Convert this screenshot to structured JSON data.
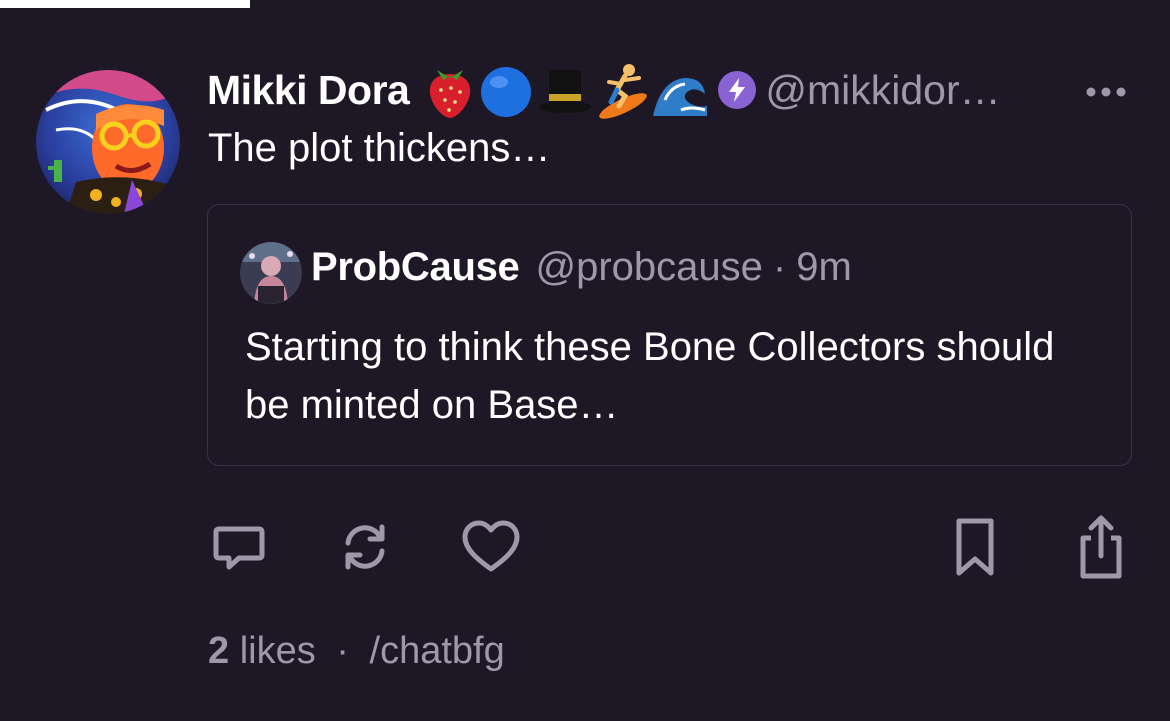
{
  "post": {
    "author": {
      "display_name": "Mikki Dora",
      "handle": "@mikkidor…",
      "emojis": [
        "strawberry",
        "blue-circle",
        "top-hat",
        "surfer",
        "wave"
      ],
      "power_badge": "power-badge-icon"
    },
    "text": "The plot thickens…",
    "quote": {
      "display_name": "ProbCause",
      "handle": "@probcause",
      "separator": "·",
      "time": "9m",
      "text": "Starting to think these Bone Collectors should be minted on Base…"
    },
    "actions": [
      "reply-icon",
      "recast-icon",
      "like-icon",
      "bookmark-icon",
      "share-icon"
    ],
    "footer": {
      "likes_count": "2",
      "likes_label": "likes",
      "separator": "·",
      "channel": "/chatbfg"
    }
  },
  "colors": {
    "background": "#1e1726",
    "primary_text": "#ffffff",
    "secondary_text": "#9f98ab",
    "power_badge": "#8a63d2",
    "border": "#3a3345"
  }
}
